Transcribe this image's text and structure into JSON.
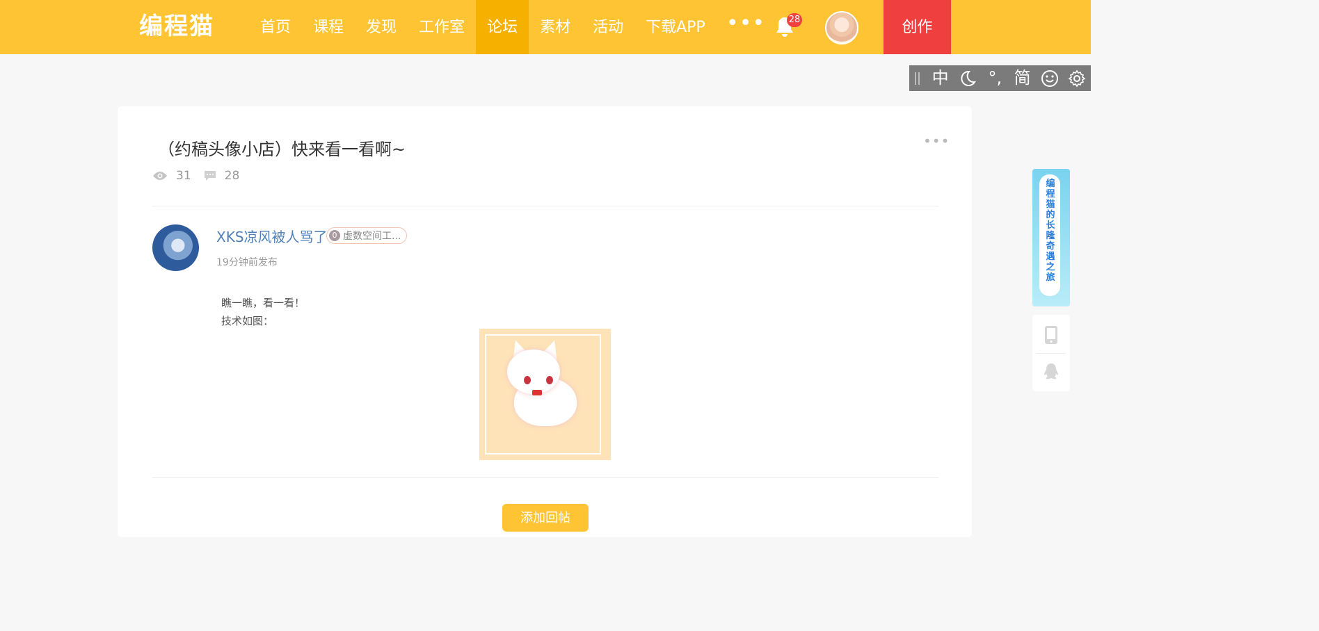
{
  "header": {
    "logo": "编程猫",
    "nav": [
      "首页",
      "课程",
      "发现",
      "工作室",
      "论坛",
      "素材",
      "活动",
      "下载APP"
    ],
    "active_nav": "论坛",
    "more": "•••",
    "notification_count": "28",
    "create_label": "创作",
    "colors": {
      "bar": "#fec433",
      "active": "#f5b000",
      "create": "#f03f3f"
    }
  },
  "readbar": {
    "lang": "中",
    "punct": "°,",
    "simplified": "简",
    "icons": [
      "grip-icon",
      "moon-icon",
      "smile-icon",
      "gear-icon"
    ]
  },
  "post": {
    "title": "（约稿头像小店）快来看一看啊~",
    "views": "31",
    "comments": "28",
    "author": "XKS凉风被人骂了",
    "level": "0",
    "level_title": "虚数空间工...",
    "time": "19分钟前发布",
    "body_lines": [
      "瞧一瞧，看一看！",
      "技术如图："
    ],
    "reply_label": "添加回帖"
  },
  "side": {
    "banner_text": "编程猫的长隆奇遇之旅",
    "icons": [
      "phone-icon",
      "qq-icon"
    ]
  }
}
